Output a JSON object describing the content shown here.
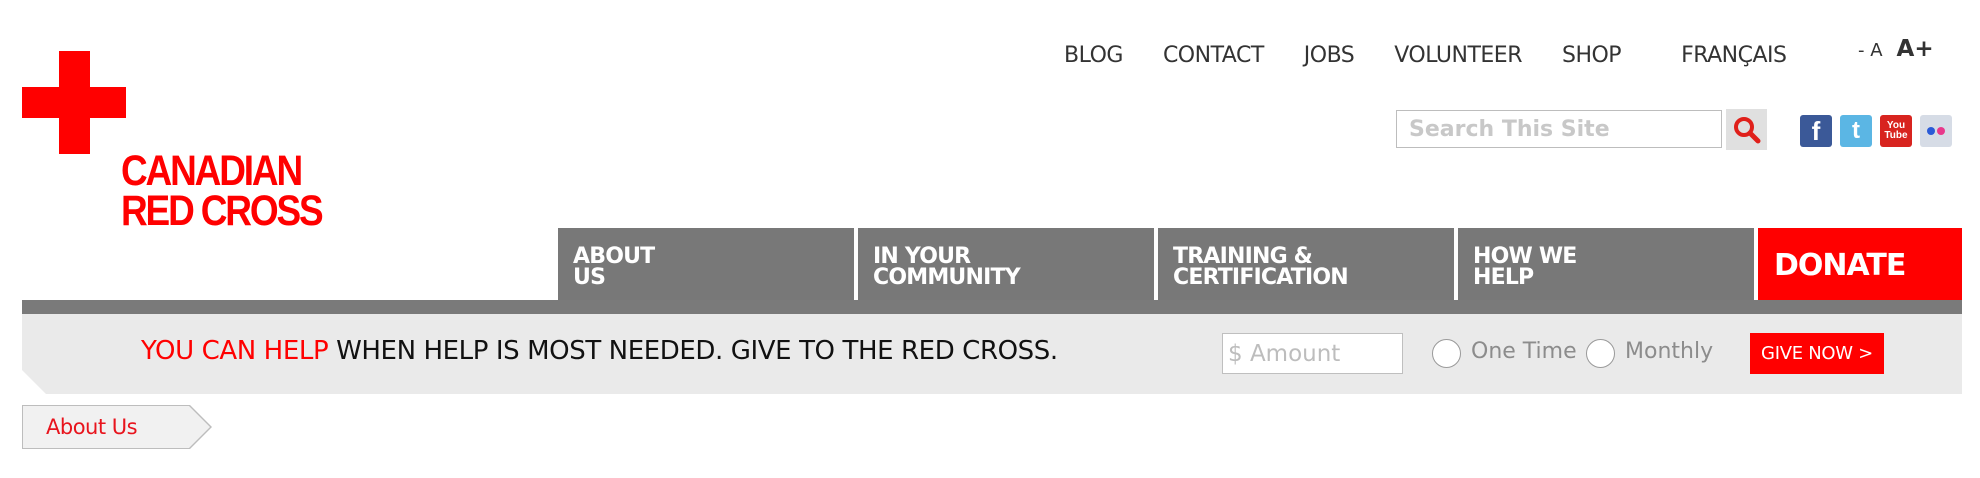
{
  "logo": {
    "line1": "CANADIAN",
    "line2": "RED CROSS",
    "brand_color": "#ff0000"
  },
  "top_nav": {
    "items": [
      "BLOG",
      "CONTACT",
      "JOBS",
      "VOLUNTEER",
      "SHOP"
    ],
    "language": "FRANÇAIS",
    "font_smaller": "- A",
    "font_larger": "A+"
  },
  "search": {
    "placeholder": "Search This Site",
    "button_icon": "search-icon"
  },
  "social": {
    "icons": [
      "facebook-icon",
      "twitter-icon",
      "youtube-icon",
      "flickr-icon"
    ],
    "facebook_glyph": "f",
    "twitter_glyph": "t",
    "youtube_line1": "You",
    "youtube_line2": "Tube"
  },
  "main_nav": {
    "items": [
      {
        "line1": "ABOUT",
        "line2": "US"
      },
      {
        "line1": "IN YOUR",
        "line2": "COMMUNITY"
      },
      {
        "line1": "TRAINING &",
        "line2": "CERTIFICATION"
      },
      {
        "line1": "HOW WE",
        "line2": "HELP"
      }
    ],
    "donate_label": "DONATE",
    "nav_color": "#787878"
  },
  "donate_strip": {
    "highlight": "YOU CAN HELP",
    "message": " WHEN HELP IS MOST NEEDED. GIVE TO THE RED CROSS.",
    "amount_placeholder": "$ Amount",
    "options": [
      "One Time",
      "Monthly"
    ],
    "button_label": "GIVE NOW >"
  },
  "breadcrumb": {
    "label": "About Us"
  }
}
